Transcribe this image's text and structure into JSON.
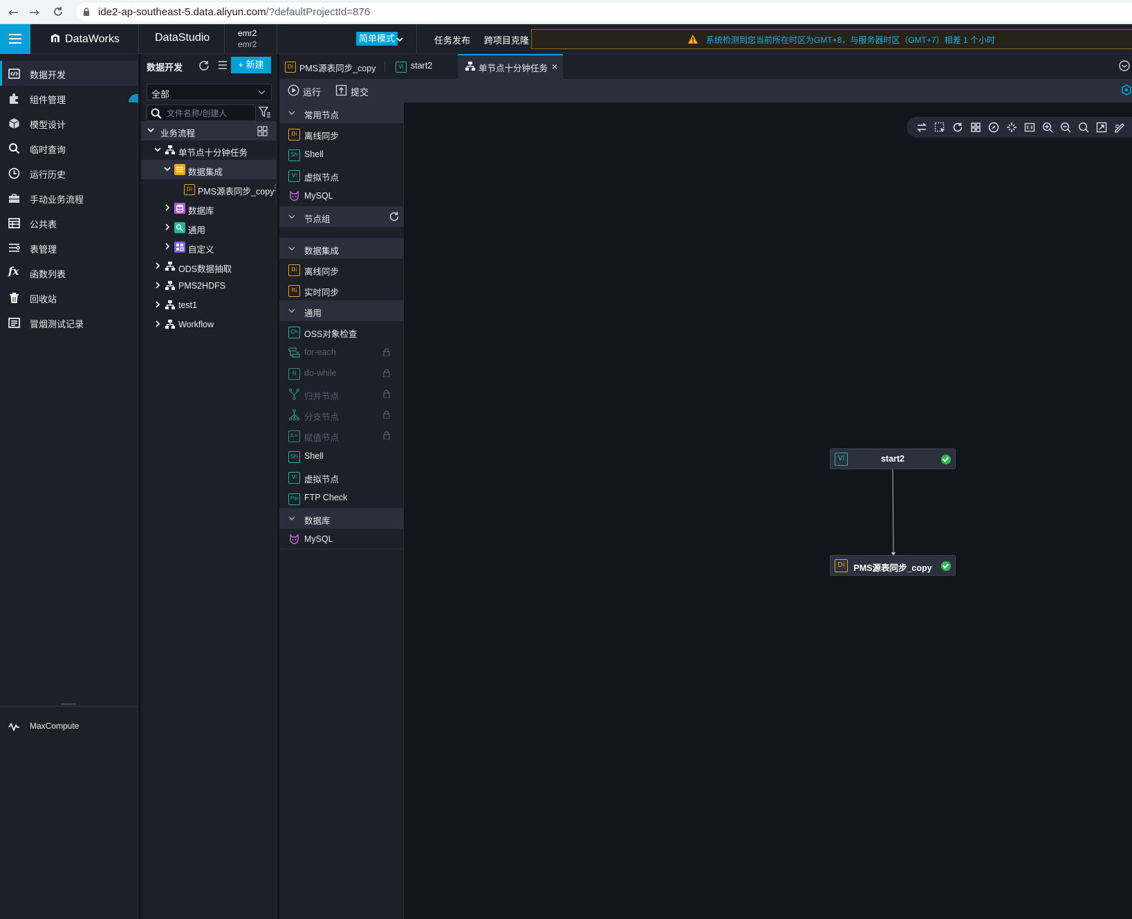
{
  "browser": {
    "url_host": "ide2-ap-southeast-5.data.aliyun.com",
    "url_path": "/?defaultProjectId=876"
  },
  "topbar": {
    "logo": "DataWorks",
    "module": "DataStudio",
    "workspace_name": "emr2",
    "workspace_sub": "emr2",
    "mode": "简单模式",
    "deploy": "任务发布",
    "clone": "跨项目克隆",
    "alert": "系统检测到您当前所在时区为GMT+8，与服务器时区（GMT+7）相差 1 个小时"
  },
  "sidebar": {
    "items": [
      {
        "label": "数据开发",
        "icon": "code-icon"
      },
      {
        "label": "组件管理",
        "icon": "puzzle-icon"
      },
      {
        "label": "模型设计",
        "icon": "cube-icon"
      },
      {
        "label": "临时查询",
        "icon": "search-icon"
      },
      {
        "label": "运行历史",
        "icon": "clock-icon"
      },
      {
        "label": "手动业务流程",
        "icon": "briefcase-icon"
      },
      {
        "label": "公共表",
        "icon": "table-icon"
      },
      {
        "label": "表管理",
        "icon": "table-manage-icon"
      },
      {
        "label": "函数列表",
        "icon": "function-icon"
      },
      {
        "label": "回收站",
        "icon": "trash-icon"
      },
      {
        "label": "冒烟测试记录",
        "icon": "log-icon"
      }
    ],
    "bottom": "MaxCompute"
  },
  "tree": {
    "title": "数据开发",
    "new_label": "+ 新建",
    "select_value": "全部",
    "search_placeholder": "文件名称/创建人",
    "rows": [
      {
        "label": "业务流程"
      },
      {
        "label": "单节点十分钟任务"
      },
      {
        "label": "数据集成"
      },
      {
        "label": "PMS源表同步_copy"
      },
      {
        "label": "数据库"
      },
      {
        "label": "通用"
      },
      {
        "label": "自定义"
      },
      {
        "label": "ODS数据抽取"
      },
      {
        "label": "PMS2HDFS"
      },
      {
        "label": "test1"
      },
      {
        "label": "Workflow"
      }
    ]
  },
  "tabs": [
    {
      "label": "PMS源表同步_copy",
      "badge": "Di"
    },
    {
      "label": "start2",
      "badge": "Vi"
    },
    {
      "label": "单节点十分钟任务"
    }
  ],
  "toolbar": {
    "run": "运行",
    "submit": "提交"
  },
  "palette": {
    "sections": [
      {
        "title": "常用节点"
      },
      {
        "title": "节点组"
      },
      {
        "title": "数据集成"
      },
      {
        "title": "通用"
      },
      {
        "title": "数据库"
      }
    ],
    "items": [
      {
        "label": "离线同步",
        "badge": "Di"
      },
      {
        "label": "Shell",
        "badge": "Sh"
      },
      {
        "label": "虚拟节点",
        "badge": "Vi"
      },
      {
        "label": "MySQL"
      },
      {
        "label": "离线同步",
        "badge": "Di"
      },
      {
        "label": "实时同步",
        "badge": "Ri"
      },
      {
        "label": "OSS对象检查",
        "badge": "Ch"
      },
      {
        "label": "for-each"
      },
      {
        "label": "do-while",
        "badge": "N"
      },
      {
        "label": "归并节点"
      },
      {
        "label": "分支节点"
      },
      {
        "label": "赋值节点",
        "badge": "A="
      },
      {
        "label": "Shell",
        "badge": "Sh"
      },
      {
        "label": "虚拟节点",
        "badge": "Vi"
      },
      {
        "label": "FTP Check",
        "badge": "Ftp"
      },
      {
        "label": "MySQL"
      }
    ]
  },
  "canvas": {
    "nodes": [
      {
        "label": "start2",
        "badge": "Vi"
      },
      {
        "label": "PMS源表同步_copy",
        "badge": "Di"
      }
    ]
  }
}
